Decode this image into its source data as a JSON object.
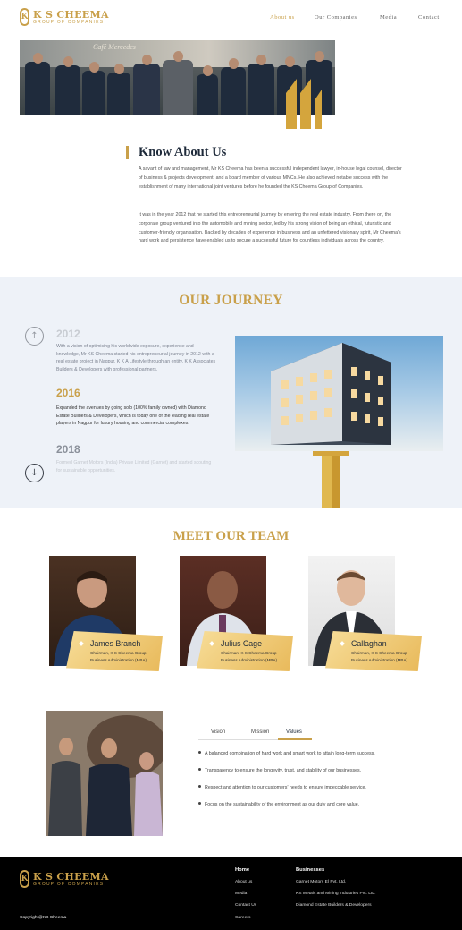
{
  "header": {
    "logo_name": "K S CHEEMA",
    "logo_sub": "GROUP OF COMPANIES",
    "nav": [
      "About us",
      "Our Companies",
      "Media",
      "Contact"
    ]
  },
  "hero": {
    "sign_text": "Café Mercedes"
  },
  "about": {
    "title": "Know About Us",
    "p1": "A savant of law and management, Mr KS Cheema has been a successful independent lawyer, in-house legal counsel, director of business & projects development, and a board member of various MNCs. He also achieved notable success with the establishment of many international joint ventures before he founded the KS Cheema Group of Companies.",
    "p2": "It was in the year 2012 that he started this entrepreneurial journey by entering the real estate industry. From there on, the corporate group ventured into the automobile and mining sector, led by his strong vision of being an ethical, futuristic and customer-friendly organisation. Backed by decades of experience in business and an unfettered visionary spirit, Mr Cheema's hard work and persistence have enabled us to secure a successful future for countless individuals across the country."
  },
  "journey": {
    "title": "OUR JOURNEY",
    "items": [
      {
        "year": "2012",
        "text": "With a vision of optimising his worldwide exposure, experience and knowledge, Mr KS Cheema started his entrepreneurial journey in 2012 with a real estate project in Nagpur, K K A Lifestyle through an entity, K K Associates Builders & Developers with professional partners."
      },
      {
        "year": "2016",
        "text": "Expanded the avenues by going solo (100% family owned) with Diamond Estate Builders & Developers, which is today one of the leading real estate players in Nagpur for luxury housing and commercial complexes."
      },
      {
        "year": "2018",
        "text": "Formed Garnet Motors (India) Private Limited (Garnet) and started scouting for sustainable opportunities."
      }
    ],
    "up_arrow": "↑",
    "down_arrow": "↓"
  },
  "team": {
    "title": "MEET OUR TEAM",
    "members": [
      {
        "name": "James Branch",
        "role": "Chairman, K S Cheema Group",
        "edu": "Business Administration (MBA)"
      },
      {
        "name": "Julius Cage",
        "role": "Chairman, K S Cheema Group",
        "edu": "Business Administration (MBA)"
      },
      {
        "name": "Callaghan",
        "role": "Chairman, K S Cheema Group",
        "edu": "Business Administration (MBA)"
      }
    ]
  },
  "values": {
    "tabs": [
      "Vision",
      "Mission",
      "Values"
    ],
    "active_tab": "Values",
    "items": [
      "A balanced combination of hard work and smart work to attain long-term success.",
      "Transparency to ensure the longevity, trust, and stability of our businesses.",
      "Respect and attention to our customers' needs to ensure impeccable service.",
      "Focus on the sustainability of the environment as our duty and core value."
    ]
  },
  "footer": {
    "logo_name": "K S CHEEMA",
    "logo_sub": "GROUP OF COMPANIES",
    "copyright": "Copyright@KS Cheema",
    "home_heading": "Home",
    "home_links": [
      "About us",
      "Media",
      "Contact Us",
      "Careers"
    ],
    "biz_heading": "Businesses",
    "biz_links": [
      "Garnet Motors El Pvt. Ltd.",
      "KS Metals and Mining Industries Pvt. Ltd.",
      "Diamond Estate Builders & Developers"
    ]
  },
  "colors": {
    "accent": "#c9a04a",
    "navy": "#1e2a3a",
    "journey_bg": "#eef2f8",
    "footer_bg": "#000000"
  }
}
